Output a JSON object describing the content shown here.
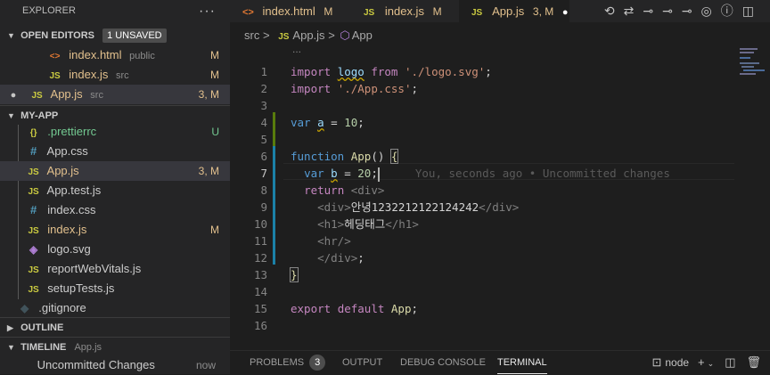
{
  "explorer": {
    "title": "EXPLORER",
    "more": "···"
  },
  "open_editors": {
    "title": "OPEN EDITORS",
    "badge": "1 UNSAVED",
    "items": [
      {
        "icon": "<>",
        "name": "index.html",
        "sub": "public",
        "status": "M"
      },
      {
        "icon": "JS",
        "name": "index.js",
        "sub": "src",
        "status": "M"
      },
      {
        "icon": "JS",
        "name": "App.js",
        "sub": "src",
        "status": "3, M",
        "dot": "●"
      }
    ]
  },
  "project": {
    "title": "MY-APP",
    "files": [
      {
        "icon": "{}",
        "name": ".prettierrc",
        "status": "U"
      },
      {
        "icon": "#",
        "name": "App.css",
        "status": ""
      },
      {
        "icon": "JS",
        "name": "App.js",
        "status": "3, M"
      },
      {
        "icon": "JS",
        "name": "App.test.js",
        "status": ""
      },
      {
        "icon": "#",
        "name": "index.css",
        "status": ""
      },
      {
        "icon": "JS",
        "name": "index.js",
        "status": "M"
      },
      {
        "icon": "◈",
        "name": "logo.svg",
        "status": ""
      },
      {
        "icon": "JS",
        "name": "reportWebVitals.js",
        "status": ""
      },
      {
        "icon": "JS",
        "name": "setupTests.js",
        "status": ""
      },
      {
        "icon": "◆",
        "name": ".gitignore",
        "status": ""
      }
    ]
  },
  "outline": {
    "title": "OUTLINE"
  },
  "timeline": {
    "title": "TIMELINE",
    "file": "App.js",
    "entry": "Uncommitted Changes",
    "time": "now"
  },
  "tabs": [
    {
      "icon": "<>",
      "label": "index.html",
      "status": "M"
    },
    {
      "icon": "JS",
      "label": "index.js",
      "status": "M"
    },
    {
      "icon": "JS",
      "label": "App.js",
      "status": "3, M",
      "dot": "●"
    }
  ],
  "breadcrumb": {
    "folder": "src",
    "sep": ">",
    "file_icon": "JS",
    "file": "App.js",
    "symbol": "App"
  },
  "editor": {
    "more": "...",
    "line_numbers": [
      "1",
      "2",
      "3",
      "4",
      "5",
      "6",
      "7",
      "8",
      "9",
      "10",
      "11",
      "12",
      "13",
      "14",
      "15",
      "16"
    ],
    "blame": "You, seconds ago • Uncommitted changes",
    "l1": {
      "kw": "import",
      "id": "logo",
      "from": "from",
      "str": "'./logo.svg'",
      "end": ";"
    },
    "l2": {
      "kw": "import",
      "str": "'./App.css'",
      "end": ";"
    },
    "l4": {
      "kw": "var",
      "id": "a",
      "op": " = ",
      "num": "10",
      "end": ";"
    },
    "l6": {
      "kw": "function",
      "name": "App",
      "rest": "() ",
      "brace": "{"
    },
    "l7": {
      "kw": "var",
      "id": "b",
      "op": " = ",
      "num": "20",
      "end": ";"
    },
    "l8": {
      "kw": "return",
      "tag": "<div>"
    },
    "l9": {
      "open": "<div>",
      "text": "안녕1232212122124242",
      "close": "</div>"
    },
    "l10": {
      "open": "<h1>",
      "text": "헤딩태그",
      "close": "</h1>"
    },
    "l11": {
      "tag": "<hr/>"
    },
    "l12": {
      "tag": "</div>",
      "end": ";"
    },
    "l13": {
      "brace": "}"
    },
    "l15": {
      "kw1": "export",
      "kw2": "default",
      "name": "App",
      "end": ";"
    }
  },
  "panel": {
    "tabs": [
      "PROBLEMS",
      "OUTPUT",
      "DEBUG CONSOLE",
      "TERMINAL"
    ],
    "problems_count": "3",
    "terminal_name": "node"
  },
  "colors": {
    "modified": "#e2c08d",
    "untracked": "#73c991",
    "js": "#cbcb41",
    "css": "#519aba",
    "html": "#e37933",
    "accent": "#0078d4"
  }
}
